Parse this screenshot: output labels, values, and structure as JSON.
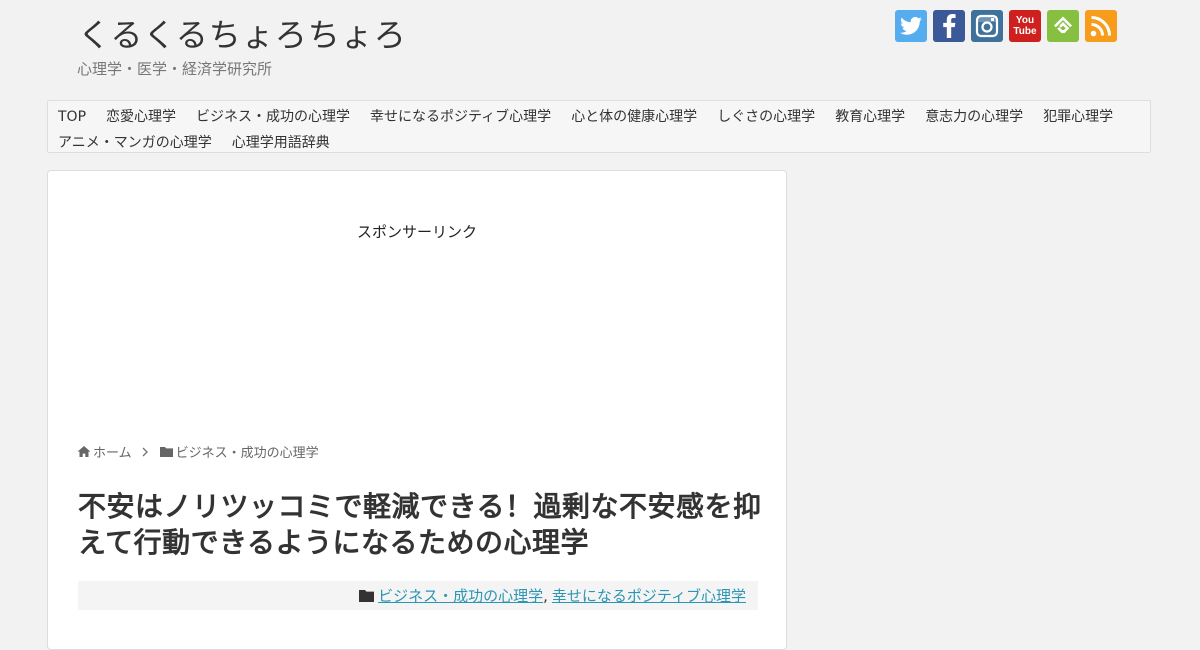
{
  "site": {
    "title": "くるくるちょろちょろ",
    "description": "心理学・医学・経済学研究所"
  },
  "social": [
    {
      "name": "twitter-icon",
      "color": "#55acee"
    },
    {
      "name": "facebook-icon",
      "color": "#3b5998"
    },
    {
      "name": "instagram-icon",
      "color": "#3f729b"
    },
    {
      "name": "youtube-icon",
      "color": "#cd201f",
      "text_top": "You",
      "text_bottom": "Tube"
    },
    {
      "name": "feedly-icon",
      "color": "#87c040"
    },
    {
      "name": "rss-icon",
      "color": "#f79c1b"
    }
  ],
  "nav": {
    "row1": [
      "TOP",
      "恋愛心理学",
      "ビジネス・成功の心理学",
      "幸せになるポジティブ心理学",
      "心と体の健康心理学",
      "しぐさの心理学",
      "教育心理学",
      "意志力の心理学",
      "犯罪心理学"
    ],
    "row2": [
      "アニメ・マンガの心理学",
      "心理学用語辞典"
    ]
  },
  "main": {
    "sponsor_label": "スポンサーリンク",
    "breadcrumb": {
      "home": "ホーム",
      "category": "ビジネス・成功の心理学"
    },
    "article_title": "不安はノリツッコミで軽減できる！過剰な不安感を抑えて行動できるようになるための心理学",
    "categories": [
      "ビジネス・成功の心理学",
      "幸せになるポジティブ心理学"
    ],
    "category_separator": ",",
    "link_color": "#2a96b3"
  }
}
